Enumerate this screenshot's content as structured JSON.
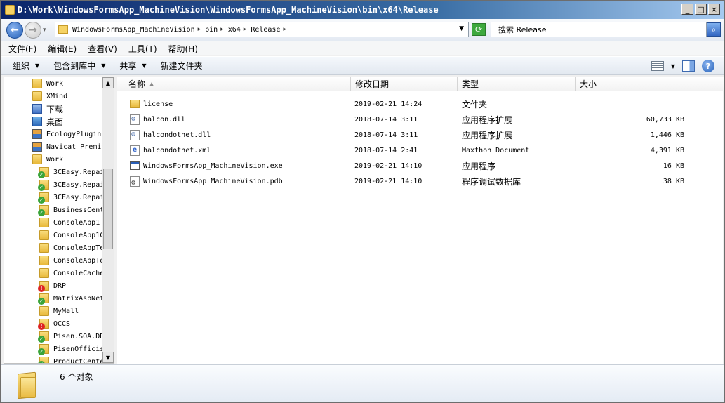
{
  "window": {
    "title": "D:\\Work\\WindowsFormsApp_MachineVision\\WindowsFormsApp_MachineVision\\bin\\x64\\Release",
    "min_label": "_",
    "max_label": "□",
    "close_label": "×"
  },
  "address": {
    "crumbs": [
      "WindowsFormsApp_MachineVision",
      "bin",
      "x64",
      "Release"
    ],
    "search_placeholder": "搜索 Release"
  },
  "menu": [
    "文件(F)",
    "编辑(E)",
    "查看(V)",
    "工具(T)",
    "帮助(H)"
  ],
  "commands": {
    "organize": "组织",
    "include_library": "包含到库中",
    "share": "共享",
    "new_folder": "新建文件夹"
  },
  "nav_items": [
    {
      "label": "Work",
      "icon": "folder-icon"
    },
    {
      "label": "XMind",
      "icon": "folder-icon"
    },
    {
      "label": "下载",
      "icon": "downloads-icon"
    },
    {
      "label": "桌面",
      "icon": "desktop-icon"
    },
    {
      "label": "EcologyPlugin.",
      "icon": "app-icon"
    },
    {
      "label": "Navicat Premiv",
      "icon": "app-icon"
    },
    {
      "label": "Work",
      "icon": "folder-icon"
    },
    {
      "label": "3CEasy.Repai",
      "icon": "svn-ok-folder-icon"
    },
    {
      "label": "3CEasy.Repai",
      "icon": "svn-ok-folder-icon"
    },
    {
      "label": "3CEasy.Repai",
      "icon": "svn-ok-folder-icon"
    },
    {
      "label": "BusinessCent",
      "icon": "svn-ok-folder-icon"
    },
    {
      "label": "ConsoleApp1",
      "icon": "folder-icon"
    },
    {
      "label": "ConsoleApp1C",
      "icon": "folder-icon"
    },
    {
      "label": "ConsoleAppTe",
      "icon": "folder-icon"
    },
    {
      "label": "ConsoleAppTe",
      "icon": "folder-icon"
    },
    {
      "label": "ConsoleCache",
      "icon": "folder-icon"
    },
    {
      "label": "DRP",
      "icon": "svn-conflict-folder-icon"
    },
    {
      "label": "MatrixAspNet",
      "icon": "svn-ok-folder-icon"
    },
    {
      "label": "MyMall",
      "icon": "folder-icon"
    },
    {
      "label": "OCCS",
      "icon": "svn-conflict-folder-icon"
    },
    {
      "label": "Pisen.SOA.DR",
      "icon": "svn-ok-folder-icon"
    },
    {
      "label": "PisenOfficis",
      "icon": "svn-ok-folder-icon"
    },
    {
      "label": "ProductCente",
      "icon": "svn-ok-folder-icon"
    }
  ],
  "columns": {
    "name": "名称",
    "date": "修改日期",
    "type": "类型",
    "size": "大小"
  },
  "files": [
    {
      "name": "license",
      "date": "2019-02-21 14:24",
      "type": "文件夹",
      "size": "",
      "icon": "folder-icon"
    },
    {
      "name": "halcon.dll",
      "date": "2018-07-14 3:11",
      "type": "应用程序扩展",
      "size": "60,733 KB",
      "icon": "dll-icon"
    },
    {
      "name": "halcondotnet.dll",
      "date": "2018-07-14 3:11",
      "type": "应用程序扩展",
      "size": "1,446 KB",
      "icon": "dll-icon"
    },
    {
      "name": "halcondotnet.xml",
      "date": "2018-07-14 2:41",
      "type": "Maxthon Document",
      "size": "4,391 KB",
      "icon": "xml-icon"
    },
    {
      "name": "WindowsFormsApp_MachineVision.exe",
      "date": "2019-02-21 14:10",
      "type": "应用程序",
      "size": "16 KB",
      "icon": "exe-icon"
    },
    {
      "name": "WindowsFormsApp_MachineVision.pdb",
      "date": "2019-02-21 14:10",
      "type": "程序调试数据库",
      "size": "38 KB",
      "icon": "pdb-icon"
    }
  ],
  "details": {
    "count_text": "6 个对象"
  }
}
